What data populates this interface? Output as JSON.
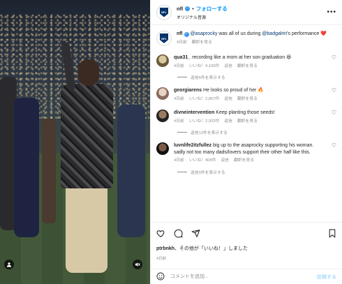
{
  "header": {
    "username": "nfl",
    "separator": "•",
    "follow_label": "フォローする",
    "subtitle": "オリジナル音源",
    "more_label": "•••"
  },
  "caption": {
    "username": "nfl",
    "mention1": "@asaprocky",
    "text1": " was all of us during ",
    "mention2": "@badgalriri",
    "text2": "'s performance ❤️",
    "time": "4日前",
    "translate": "翻訳を見る"
  },
  "comments": [
    {
      "username": "qua31_",
      "text": " recording like a mom at her son graduation 😆",
      "time": "4日前",
      "likes": "いいね！4,100件",
      "reply": "返信",
      "translate": "翻訳を見る",
      "replies": "返信6件を表示する"
    },
    {
      "username": "georgiarens",
      "text": " He looks so proud of her 🔥",
      "time": "4日前",
      "likes": "いいね！2,857件",
      "reply": "返信",
      "translate": "翻訳を見る",
      "replies": ""
    },
    {
      "username": "divneintervention",
      "text": " Keep planting those seeds!",
      "time": "4日前",
      "likes": "いいね！2,932件",
      "reply": "返信",
      "translate": "翻訳を見る",
      "replies": "返信12件を表示する"
    },
    {
      "username": "luvnlife2itzfullez",
      "text": " big up to the asaprocky supporting his woman. sadly not too many dads/lovers support their other half like this.",
      "time": "4日前",
      "likes": "いいね！404件",
      "reply": "返信",
      "translate": "翻訳を見る",
      "replies": "返信9件を表示する"
    }
  ],
  "footer": {
    "liked_by_user": "ptrbnkh",
    "liked_by_text": "、その他が「いいね！」しました",
    "date": "4日前",
    "comment_placeholder": "コメントを追加...",
    "post_label": "投稿する"
  },
  "media": {
    "logo_text": "NFL"
  },
  "colors": {
    "accent": "#0095f6",
    "verified": "#3897f0",
    "like_red": "#ed4956",
    "nfl_blue": "#013369"
  },
  "icons": [
    "heart-icon",
    "comment-icon",
    "share-icon",
    "bookmark-icon",
    "emoji-icon",
    "user-tag-icon",
    "mute-icon",
    "verified-icon",
    "more-icon"
  ]
}
